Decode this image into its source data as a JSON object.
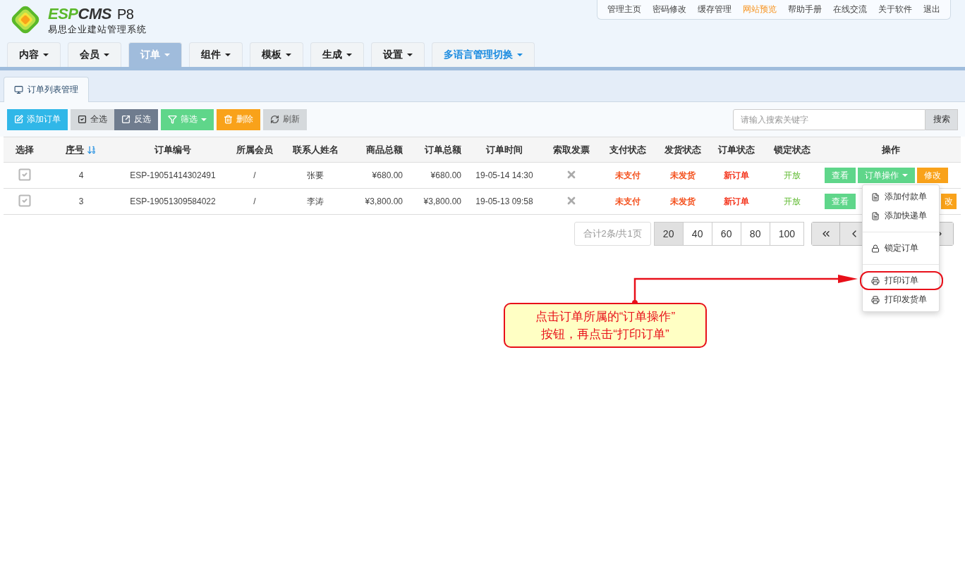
{
  "logo": {
    "brand_a": "ESP",
    "brand_b": "CMS",
    "version": "P8",
    "subtitle": "易思企业建站管理系统"
  },
  "top_links": [
    {
      "label": "管理主页",
      "highlighted": false
    },
    {
      "label": "密码修改",
      "highlighted": false
    },
    {
      "label": "缓存管理",
      "highlighted": false
    },
    {
      "label": "网站预览",
      "highlighted": true
    },
    {
      "label": "帮助手册",
      "highlighted": false
    },
    {
      "label": "在线交流",
      "highlighted": false
    },
    {
      "label": "关于软件",
      "highlighted": false
    },
    {
      "label": "退出",
      "highlighted": false
    }
  ],
  "nav_tabs": [
    {
      "label": "内容",
      "selected": false,
      "kind": "menu"
    },
    {
      "label": "会员",
      "selected": false,
      "kind": "menu"
    },
    {
      "label": "订单",
      "selected": true,
      "kind": "menu"
    },
    {
      "label": "组件",
      "selected": false,
      "kind": "menu"
    },
    {
      "label": "模板",
      "selected": false,
      "kind": "menu"
    },
    {
      "label": "生成",
      "selected": false,
      "kind": "menu"
    },
    {
      "label": "设置",
      "selected": false,
      "kind": "menu"
    },
    {
      "label": "多语言管理切换",
      "selected": false,
      "kind": "lang"
    }
  ],
  "page_tabs": [
    {
      "label": "订单列表管理",
      "selected": true
    }
  ],
  "toolbar": [
    {
      "label": "添加订单",
      "kind": "add"
    },
    {
      "label": "全选",
      "kind": "all"
    },
    {
      "label": "反选",
      "kind": "invert"
    },
    {
      "label": "筛选",
      "kind": "filter"
    },
    {
      "label": "删除",
      "kind": "delete"
    },
    {
      "label": "刷新",
      "kind": "refresh"
    }
  ],
  "search": {
    "placeholder": "请输入搜索关键字",
    "button": "搜索"
  },
  "table": {
    "columns": [
      {
        "label": "选择",
        "sortable": false
      },
      {
        "label": "序号",
        "sortable": true
      },
      {
        "label": "订单编号",
        "sortable": false
      },
      {
        "label": "所属会员",
        "sortable": false
      },
      {
        "label": "联系人姓名",
        "sortable": false
      },
      {
        "label": "商品总额",
        "sortable": false
      },
      {
        "label": "订单总额",
        "sortable": false
      },
      {
        "label": "订单时间",
        "sortable": false
      },
      {
        "label": "索取发票",
        "sortable": false
      },
      {
        "label": "支付状态",
        "sortable": false
      },
      {
        "label": "发货状态",
        "sortable": false
      },
      {
        "label": "订单状态",
        "sortable": false
      },
      {
        "label": "锁定状态",
        "sortable": false
      },
      {
        "label": "操作",
        "sortable": false
      }
    ],
    "rows": [
      {
        "checked": true,
        "seq": "4",
        "order_no": "ESP-19051414302491",
        "member": "/",
        "contact": "张要",
        "goods_total": "¥680.00",
        "order_total": "¥680.00",
        "time": "19-05-14 14:30",
        "invoice": false,
        "pay_status": "未支付",
        "ship_status": "未发货",
        "order_status": "新订单",
        "lock_status": "开放",
        "actions": [
          {
            "label": "查看",
            "kind": "view"
          },
          {
            "label": "订单操作",
            "kind": "menu"
          },
          {
            "label": "修改",
            "kind": "edit"
          }
        ]
      },
      {
        "checked": true,
        "seq": "3",
        "order_no": "ESP-19051309584022",
        "member": "/",
        "contact": "李涛",
        "goods_total": "¥3,800.00",
        "order_total": "¥3,800.00",
        "time": "19-05-13 09:58",
        "invoice": false,
        "pay_status": "未支付",
        "ship_status": "未发货",
        "order_status": "新订单",
        "lock_status": "开放",
        "actions": [
          {
            "label": "查看",
            "kind": "view"
          },
          {
            "label": "改",
            "kind": "edit"
          }
        ]
      }
    ]
  },
  "pagination": {
    "info": "合计2条/共1页",
    "sizes": [
      {
        "label": "20",
        "selected": true
      },
      {
        "label": "40",
        "selected": false
      },
      {
        "label": "60",
        "selected": false
      },
      {
        "label": "80",
        "selected": false
      },
      {
        "label": "100",
        "selected": false
      }
    ]
  },
  "dropdown_menu": [
    {
      "label": "添加付款单",
      "kind": "doc",
      "highlighted": false
    },
    {
      "label": "添加快递单",
      "kind": "doc",
      "highlighted": false
    },
    {
      "kind": "divider"
    },
    {
      "label": "锁定订单",
      "kind": "lock",
      "highlighted": false
    },
    {
      "kind": "divider"
    },
    {
      "label": "打印订单",
      "kind": "print",
      "highlighted": true
    },
    {
      "label": "打印发货单",
      "kind": "print",
      "highlighted": false
    }
  ],
  "callout": {
    "text": "点击订单所属的“订单操作”\n按钮，再点击“打印订单”"
  }
}
